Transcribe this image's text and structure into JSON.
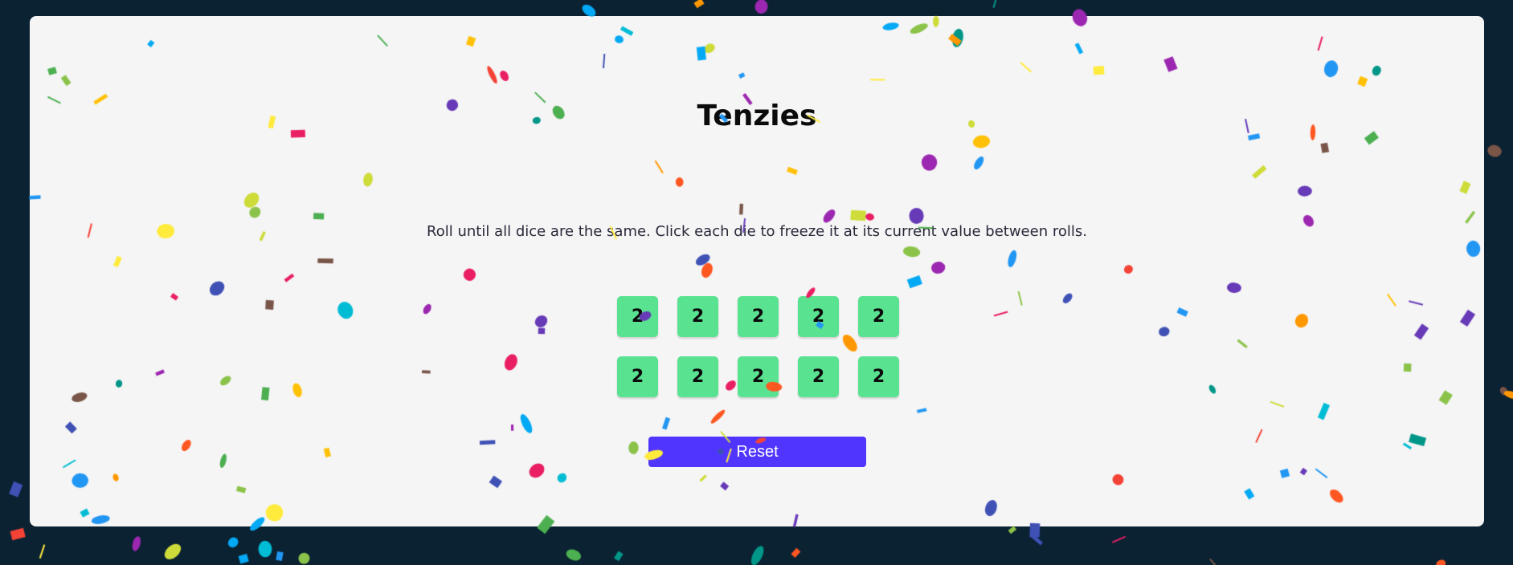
{
  "game": {
    "title": "Tenzies",
    "instructions": "Roll until all dice are the same. Click each die to freeze it at its current value between rolls.",
    "dice": [
      {
        "value": "2"
      },
      {
        "value": "2"
      },
      {
        "value": "2"
      },
      {
        "value": "2"
      },
      {
        "value": "2"
      },
      {
        "value": "2"
      },
      {
        "value": "2"
      },
      {
        "value": "2"
      },
      {
        "value": "2"
      },
      {
        "value": "2"
      }
    ],
    "reset_label": "Reset"
  },
  "colors": {
    "page_background": "#0b2233",
    "card_background": "#f5f5f5",
    "die_held": "#59e391",
    "button": "#5035ff",
    "confetti": [
      "#f44336",
      "#e91e63",
      "#9c27b0",
      "#673ab7",
      "#3f51b5",
      "#2196f3",
      "#03a9f4",
      "#00bcd4",
      "#009688",
      "#4caf50",
      "#8bc34a",
      "#cddc39",
      "#ffeb3b",
      "#ffc107",
      "#ff9800",
      "#ff5722",
      "#795548"
    ]
  }
}
